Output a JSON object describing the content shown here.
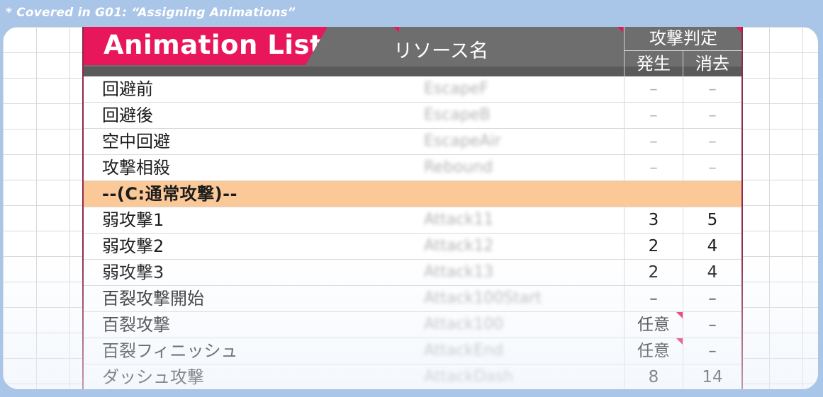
{
  "caption": "* Covered in G01: “Assigning Animations”",
  "sheet": {
    "title": "Animation List",
    "resource_header": "リソース名",
    "attack_header": "攻撃判定",
    "start_header": "発生",
    "end_header": "消去",
    "rows": [
      {
        "name": "回避前",
        "resource": "EscapeF",
        "start": "–",
        "end": "–",
        "section": false
      },
      {
        "name": "回避後",
        "resource": "EscapeB",
        "start": "–",
        "end": "–",
        "section": false
      },
      {
        "name": "空中回避",
        "resource": "EscapeAir",
        "start": "–",
        "end": "–",
        "section": false
      },
      {
        "name": "攻撃相殺",
        "resource": "Rebound",
        "start": "–",
        "end": "–",
        "section": false
      },
      {
        "name": "--(C:通常攻撃)--",
        "resource": "",
        "start": "",
        "end": "",
        "section": true
      },
      {
        "name": "弱攻撃1",
        "resource": "Attack11",
        "start": "3",
        "end": "5",
        "section": false
      },
      {
        "name": "弱攻撃2",
        "resource": "Attack12",
        "start": "2",
        "end": "4",
        "section": false
      },
      {
        "name": "弱攻撃3",
        "resource": "Attack13",
        "start": "2",
        "end": "4",
        "section": false
      },
      {
        "name": "百裂攻撃開始",
        "resource": "Attack100Start",
        "start": "–",
        "end": "–",
        "section": false
      },
      {
        "name": "百裂攻撃",
        "resource": "Attack100",
        "start": "任意",
        "end": "–",
        "section": false,
        "note": true
      },
      {
        "name": "百裂フィニッシュ",
        "resource": "AttackEnd",
        "start": "任意",
        "end": "–",
        "section": false,
        "note": true
      },
      {
        "name": "ダッシュ攻撃",
        "resource": "AttackDash",
        "start": "8",
        "end": "14",
        "section": false
      }
    ]
  }
}
